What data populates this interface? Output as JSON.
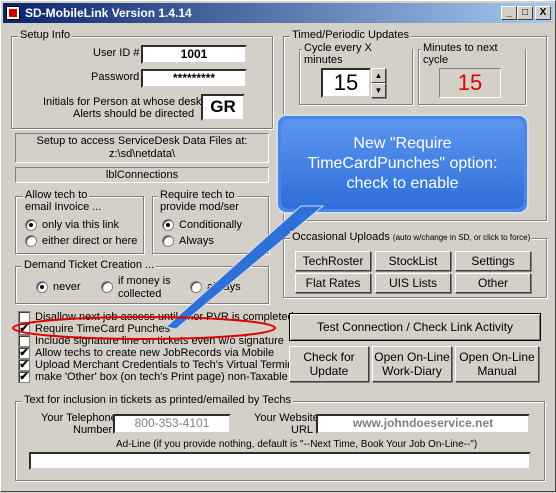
{
  "window": {
    "title": "SD-MobileLink Version 1.4.14",
    "controls": {
      "minimize": "_",
      "maximize": "□",
      "close": "X"
    }
  },
  "setup": {
    "label": "Setup Info",
    "userid_label": "User ID #",
    "userid_value": "1001",
    "password_label": "Password",
    "password_value": "*********",
    "initials_label_line1": "Initials for Person at whose desk",
    "initials_label_line2": "Alerts should be directed",
    "initials_value": "GR",
    "datafiles_line1": "Setup to access ServiceDesk Data Files at:",
    "datafiles_line2": "z:\\sd\\netdata\\",
    "connection": "lblConnections"
  },
  "email_invoice": {
    "label_line1": "Allow tech to",
    "label_line2": "email Invoice ...",
    "opt1": "only via this link",
    "opt2": "either direct or here"
  },
  "modser": {
    "label_line1": "Require tech to",
    "label_line2": "provide mod/ser",
    "opt1": "Conditionally",
    "opt2": "Always"
  },
  "demand_ticket": {
    "label": "Demand Ticket Creation ...",
    "opt1": "never",
    "opt2_line1": "if money is",
    "opt2_line2": "collected",
    "opt3": "always"
  },
  "checkboxes": [
    {
      "label": "Disallow next job access until prior PVR is completed",
      "checked": false
    },
    {
      "label": "Require TimeCard Punches",
      "checked": true
    },
    {
      "label": "Include signature line on tickets even w/o signature",
      "checked": false
    },
    {
      "label": "Allow techs to create new JobRecords via Mobile",
      "checked": true
    },
    {
      "label": "Upload Merchant Credentials to Tech's Virtual Terminal",
      "checked": true
    },
    {
      "label": "make 'Other' box (on tech's Print page) non-Taxable",
      "checked": true
    }
  ],
  "timed": {
    "label": "Timed/Periodic Updates",
    "cycle_label": "Cycle every X minutes",
    "cycle_value": "15",
    "next_label": "Minutes to next cycle",
    "next_value": "15"
  },
  "callout": {
    "line1": "New \"Require",
    "line2": "TimeCardPunches\" option:",
    "line3": "check to enable"
  },
  "occasional": {
    "label": "Occasional Uploads",
    "note": "(auto w/change in SD, or click to force)",
    "buttons": [
      "TechRoster",
      "StockList",
      "Settings",
      "Flat Rates",
      "UIS Lists",
      "Other"
    ]
  },
  "actions": {
    "test_connection": "Test Connection / Check Link Activity",
    "check_update_line1": "Check for",
    "check_update_line2": "Update",
    "diary_line1": "Open On-Line",
    "diary_line2": "Work-Diary",
    "manual_line1": "Open On-Line",
    "manual_line2": "Manual"
  },
  "inclusion": {
    "label": "Text for inclusion in tickets as printed/emailed by Techs",
    "phone_label_line1": "Your Telephone",
    "phone_label_line2": "Number",
    "phone_value": "800-353-4101",
    "website_label_line1": "Your Website",
    "website_label_line2": "URL",
    "website_value": "www.johndoeservice.net",
    "adline_label": "Ad-Line (if you provide nothing, default is \"--Next Time, Book Your Job On-Line--\")",
    "adline_value": ""
  },
  "colors": {
    "title_start": "#0a246a",
    "title_end": "#a6caf0",
    "counter_red": "#e00000",
    "callout_blue": "#4a86e8",
    "highlight_red": "#e00000"
  }
}
